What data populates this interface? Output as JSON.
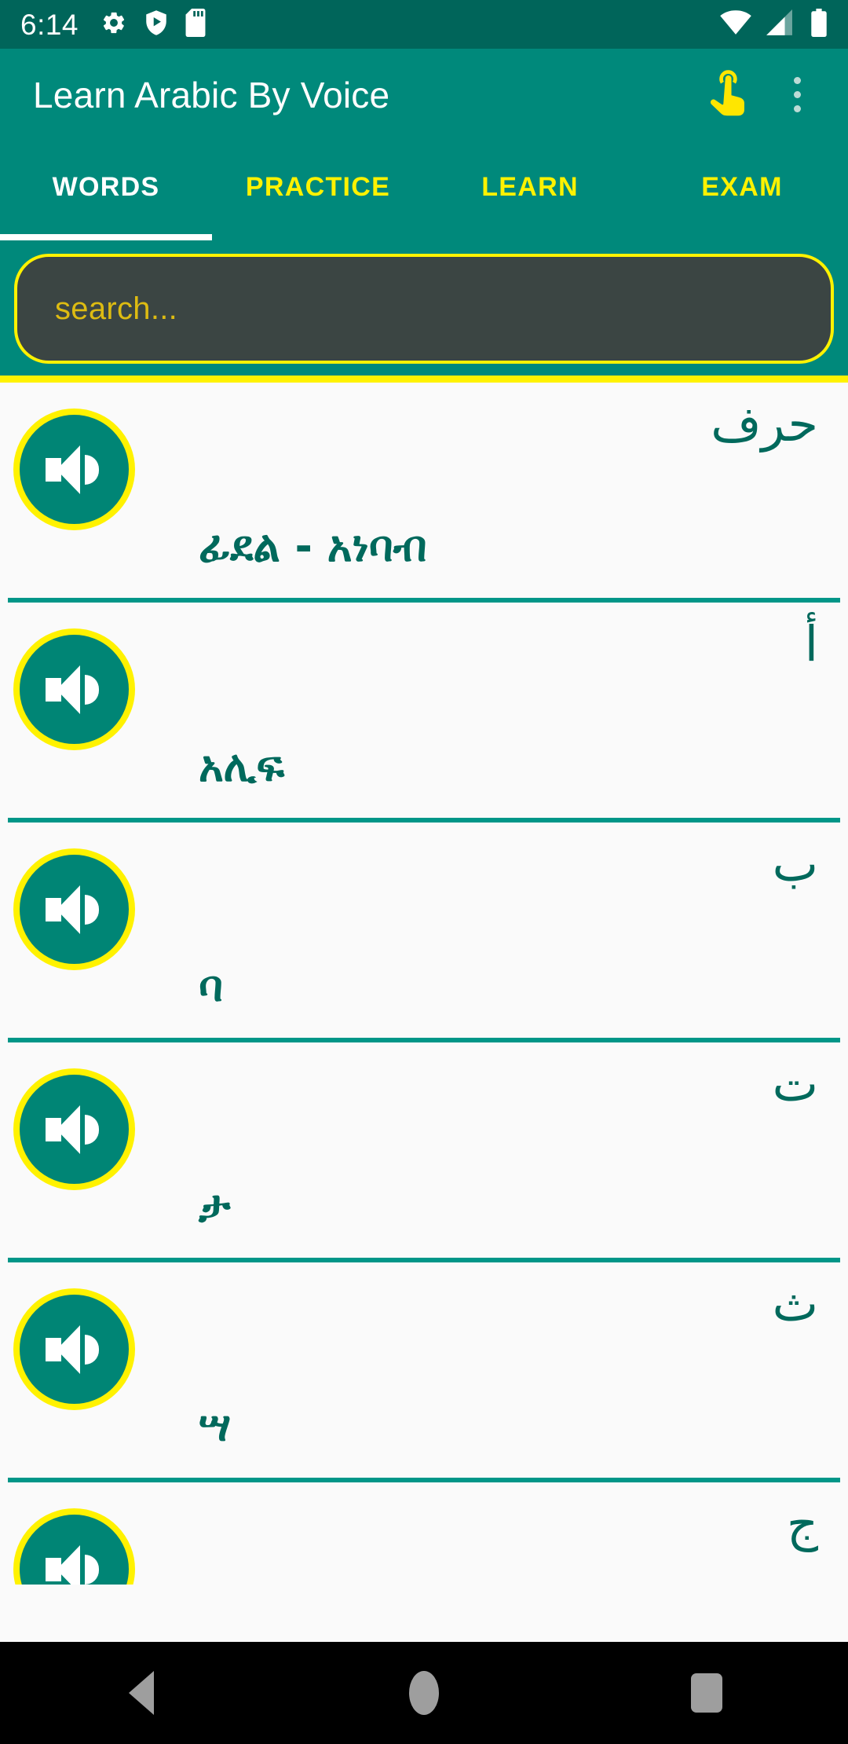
{
  "status_bar": {
    "time": "6:14",
    "left_icons": [
      "gear-icon",
      "play-protect-icon",
      "sd-card-icon"
    ],
    "right_icons": [
      "wifi-icon",
      "cellular-signal-icon",
      "battery-icon"
    ]
  },
  "app_bar": {
    "title": "Learn Arabic By Voice",
    "touch_action_icon": "touch-hand-icon",
    "overflow_icon": "overflow-menu-icon"
  },
  "tabs": [
    {
      "label": "WORDS",
      "active": true
    },
    {
      "label": "PRACTICE",
      "active": false
    },
    {
      "label": "LEARN",
      "active": false
    },
    {
      "label": "EXAM",
      "active": false
    }
  ],
  "search": {
    "value": "",
    "placeholder": "search..."
  },
  "word_list": [
    {
      "arabic": "حرف",
      "amharic": "ፊደል - አነባብ",
      "speaker_icon": "speaker-icon"
    },
    {
      "arabic": "أ",
      "amharic": "አሊፍ",
      "speaker_icon": "speaker-icon"
    },
    {
      "arabic": "ب",
      "amharic": "ባ",
      "speaker_icon": "speaker-icon"
    },
    {
      "arabic": "ت",
      "amharic": "ታ",
      "speaker_icon": "speaker-icon"
    },
    {
      "arabic": "ث",
      "amharic": "ሣ",
      "speaker_icon": "speaker-icon"
    },
    {
      "arabic": "ج",
      "amharic": "",
      "speaker_icon": "speaker-icon"
    }
  ],
  "nav_bar": {
    "back": "back-nav-icon",
    "home": "home-nav-icon",
    "recents": "recents-nav-icon"
  },
  "colors": {
    "status_bar": "#00655a",
    "app_bar": "#00897b",
    "accent_yellow": "#fff200",
    "text_teal": "#00695c",
    "speaker_fill": "#008575",
    "search_field": "#3b4543",
    "list_background": "#fafafa",
    "divider": "#009688"
  }
}
